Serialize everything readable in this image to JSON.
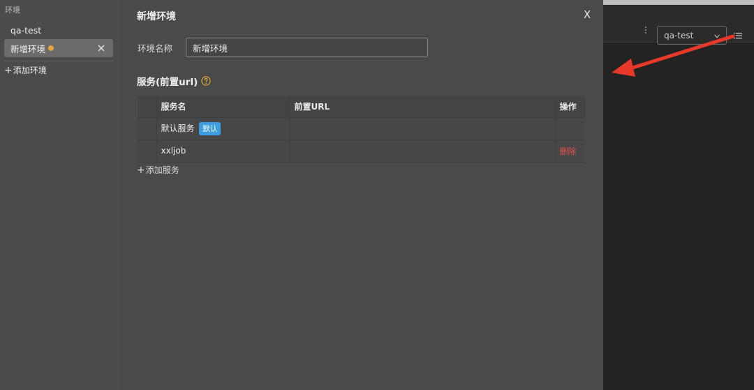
{
  "sidebar": {
    "title": "环境",
    "items": [
      {
        "label": "qa-test"
      },
      {
        "label": "新增环境"
      }
    ],
    "add_label": "添加环境"
  },
  "panel": {
    "title": "新增环境",
    "close_label": "X",
    "name_label": "环境名称",
    "name_value": "新增环境",
    "services_title": "服务(前置url)",
    "table": {
      "headers": [
        "服务名",
        "前置URL",
        "操作"
      ],
      "rows": [
        {
          "name": "默认服务",
          "badge": "默认",
          "url": "",
          "action": ""
        },
        {
          "name": "xxljob",
          "badge": "",
          "url": "",
          "action": "删除"
        }
      ]
    },
    "add_service_label": "添加服务"
  },
  "right_toolbar": {
    "env_select_value": "qa-test"
  },
  "colors": {
    "unsaved_dot": "#e8a33b",
    "badge": "#3d9de0",
    "delete": "#e0524f",
    "annotation_arrow": "#e8382a",
    "help_icon": "#e0a83a"
  },
  "icons": {
    "help": "question-circle-icon",
    "close": "close-icon",
    "plus": "plus-icon",
    "more": "kebab-icon",
    "dropdown": "chevron-down-icon",
    "list": "list-icon"
  }
}
